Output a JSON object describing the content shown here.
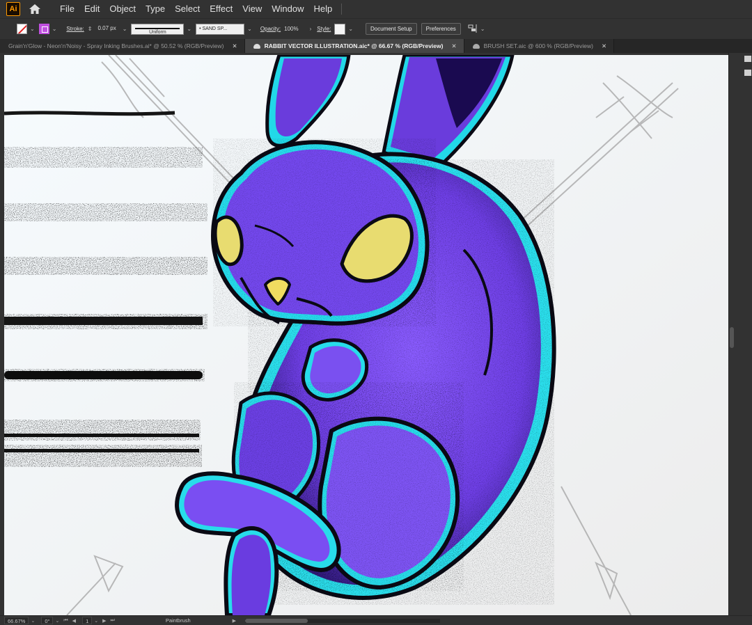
{
  "app": {
    "logo_text": "Ai"
  },
  "menu": [
    "File",
    "Edit",
    "Object",
    "Type",
    "Select",
    "Effect",
    "View",
    "Window",
    "Help"
  ],
  "control_bar": {
    "stroke_label": "Stroke:",
    "stroke_weight": "0.07 px",
    "profile": "Uniform",
    "brush": "• SAND SP...",
    "opacity_label": "Opacity:",
    "opacity_value": "100%",
    "style_label": "Style:",
    "document_setup": "Document Setup",
    "preferences": "Preferences"
  },
  "tabs": [
    {
      "label": "Grain'n'Glow - Neon'n'Noisy - Spray Inking Brushes.ai* @ 50.52 % (RGB/Preview)",
      "active": false,
      "cloud": false
    },
    {
      "label": "RABBIT VECTOR ILLUSTRATION.aic* @ 66.67 % (RGB/Preview)",
      "active": true,
      "cloud": true
    },
    {
      "label": "BRUSH SET.aic @ 600 % (RGB/Preview)",
      "active": false,
      "cloud": true
    }
  ],
  "status_bar": {
    "zoom": "66.67%",
    "rotation": "0°",
    "artboard": "1",
    "tool": "Paintbrush"
  },
  "colors": {
    "rabbit_purple": "#7a4cf0",
    "rabbit_dark": "#3a1fa0",
    "glow_cyan": "#35e8f0",
    "eye_yellow": "#e8dc70",
    "canvas_bg": "#f4f4f4"
  }
}
